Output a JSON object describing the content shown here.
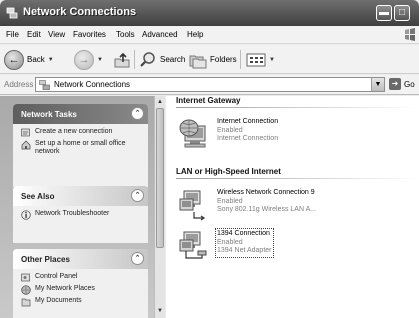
{
  "window": {
    "title": "Network Connections"
  },
  "menu": {
    "items": [
      "File",
      "Edit",
      "View",
      "Favorites",
      "Tools",
      "Advanced",
      "Help"
    ]
  },
  "toolbar": {
    "back_label": "Back",
    "search_label": "Search",
    "folders_label": "Folders"
  },
  "address": {
    "label": "Address",
    "value": "Network Connections",
    "go_label": "Go"
  },
  "sidebar": {
    "network_tasks": {
      "title": "Network Tasks",
      "items": [
        {
          "label": "Create a new connection",
          "icon": "new-connection-icon"
        },
        {
          "label": "Set up a home or small office network",
          "icon": "home-network-icon"
        }
      ]
    },
    "see_also": {
      "title": "See Also",
      "items": [
        {
          "label": "Network Troubleshooter",
          "icon": "info-icon"
        }
      ]
    },
    "other_places": {
      "title": "Other Places",
      "items": [
        {
          "label": "Control Panel",
          "icon": "control-panel-icon"
        },
        {
          "label": "My Network Places",
          "icon": "network-places-icon"
        },
        {
          "label": "My Documents",
          "icon": "documents-icon"
        }
      ]
    }
  },
  "groups": [
    {
      "title": "Internet Gateway",
      "connections": [
        {
          "name": "Internet Connection",
          "status": "Enabled",
          "detail": "Internet Connection",
          "icon": "internet-gateway-icon"
        }
      ]
    },
    {
      "title": "LAN or High-Speed Internet",
      "connections": [
        {
          "name": "Wireless Network Connection 9",
          "status": "Enabled",
          "detail": "Sony 802.11g Wireless LAN A...",
          "icon": "wireless-connection-icon"
        },
        {
          "name": "1394 Connection",
          "status": "Enabled",
          "detail": "1394 Net Adapter",
          "icon": "lan-connection-icon"
        }
      ]
    }
  ]
}
